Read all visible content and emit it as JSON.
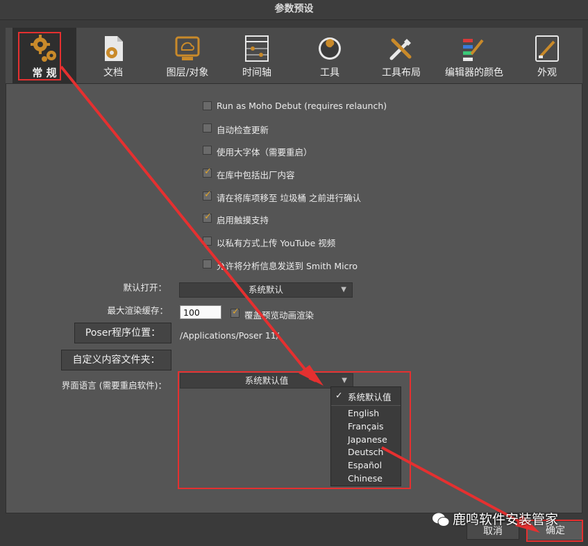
{
  "window": {
    "title": "参数预设"
  },
  "tabs": [
    {
      "label": "常 规",
      "icon": "gears-icon",
      "active": true
    },
    {
      "label": "文档",
      "icon": "document-gear-icon"
    },
    {
      "label": "图层/对象",
      "icon": "layer-object-icon"
    },
    {
      "label": "时间轴",
      "icon": "timeline-icon"
    },
    {
      "label": "工具",
      "icon": "wrench-icon"
    },
    {
      "label": "工具布局",
      "icon": "tool-layout-icon"
    },
    {
      "label": "编辑器的颜色",
      "icon": "editor-colors-icon"
    },
    {
      "label": "外观",
      "icon": "appearance-icon"
    }
  ],
  "checkboxes": [
    {
      "label": "Run as Moho Debut (requires relaunch)",
      "checked": false
    },
    {
      "label": "自动检查更新",
      "checked": false
    },
    {
      "label": "使用大字体（需要重启）",
      "checked": false
    },
    {
      "label": "在库中包括出厂内容",
      "checked": true
    },
    {
      "label": "请在将库项移至 垃圾桶 之前进行确认",
      "checked": true
    },
    {
      "label": "启用触摸支持",
      "checked": true
    },
    {
      "label": "以私有方式上传 YouTube 视频",
      "checked": false
    },
    {
      "label": "允许将分析信息发送到 Smith Micro",
      "checked": false
    }
  ],
  "default_open": {
    "label": "默认打开：",
    "value": "系统默认"
  },
  "render_cache": {
    "label": "最大渲染缓存：",
    "value": "100",
    "override_label": "覆盖预览动画渲染",
    "override_checked": true
  },
  "poser": {
    "button": "Poser程序位置：",
    "path": "/Applications/Poser 11/"
  },
  "custom_content": {
    "button": "自定义内容文件夹："
  },
  "language": {
    "label": "界面语言 (需要重启软件)：",
    "value": "系统默认值",
    "options": [
      "系统默认值",
      "English",
      "Français",
      "Japanese",
      "Deutsch",
      "Español",
      "Chinese"
    ],
    "selected_index": 0
  },
  "footer": {
    "cancel": "取消",
    "ok": "确定"
  },
  "watermark": {
    "text": "鹿鸣软件安装管家"
  },
  "colors": {
    "accent_red": "#e53030",
    "check_orange": "#e0a52a"
  }
}
